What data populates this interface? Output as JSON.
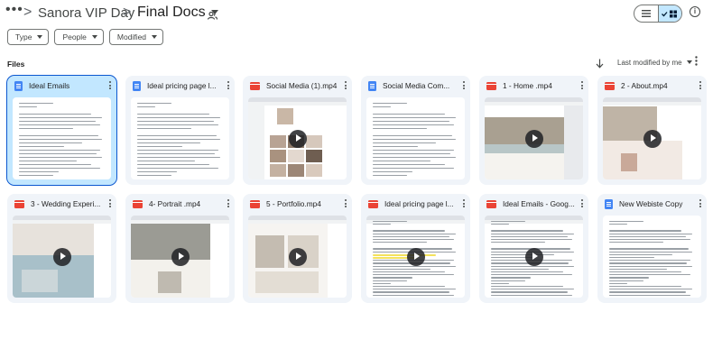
{
  "breadcrumb": {
    "more": "•••",
    "sep": ">",
    "parent": "Sanora VIP Day",
    "current": "Final Docs"
  },
  "icons": {
    "shared": "people-shared-icon",
    "list_view": "list-view-icon",
    "grid_view": "grid-view-icon",
    "info": "info-icon",
    "sort_arrow": "arrow-down-icon",
    "doc": "google-docs-icon",
    "video": "video-file-icon",
    "play": "play-icon",
    "more": "more-vert-icon"
  },
  "info_glyph": "i",
  "filters": [
    {
      "label": "Type"
    },
    {
      "label": "People"
    },
    {
      "label": "Modified"
    }
  ],
  "section_label": "Files",
  "sort": {
    "label": "Last modified by me"
  },
  "colors": {
    "selected_card": "#c2e7ff",
    "card_bg": "#f0f4f9",
    "doc_icon": "#4285f4",
    "video_icon": "#ea4335",
    "accent": "#0b57d0"
  },
  "files": [
    {
      "name": "Ideal Emails",
      "kind": "doc",
      "selected": true
    },
    {
      "name": "Ideal pricing page l...",
      "kind": "doc",
      "selected": false
    },
    {
      "name": "Social Media (1).mp4",
      "kind": "video",
      "selected": false
    },
    {
      "name": "Social Media Com...",
      "kind": "doc",
      "selected": false
    },
    {
      "name": "1 - Home .mp4",
      "kind": "video",
      "selected": false
    },
    {
      "name": "2 - About.mp4",
      "kind": "video",
      "selected": false
    },
    {
      "name": "3 - Wedding Experi...",
      "kind": "video",
      "selected": false
    },
    {
      "name": "4- Portrait .mp4",
      "kind": "video",
      "selected": false
    },
    {
      "name": "5 - Portfolio.mp4",
      "kind": "video",
      "selected": false
    },
    {
      "name": "Ideal pricing page l...",
      "kind": "video",
      "selected": false
    },
    {
      "name": "Ideal Emails - Goog...",
      "kind": "video",
      "selected": false
    },
    {
      "name": "New Webiste Copy",
      "kind": "doc",
      "selected": false
    }
  ]
}
